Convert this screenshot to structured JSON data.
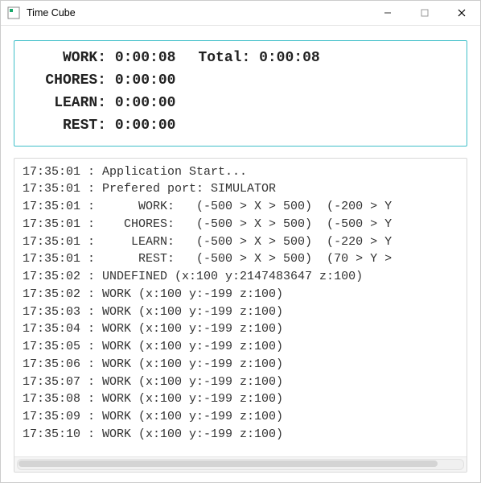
{
  "window": {
    "title": "Time Cube"
  },
  "timers": {
    "work_label": "WORK:",
    "work_value": "0:00:08",
    "chores_label": "CHORES:",
    "chores_value": "0:00:00",
    "learn_label": "LEARN:",
    "learn_value": "0:00:00",
    "rest_label": "REST:",
    "rest_value": "0:00:00",
    "total_label": "Total:",
    "total_value": "0:00:08"
  },
  "log_lines": [
    "17:35:01 : Application Start...",
    "17:35:01 : Prefered port: SIMULATOR",
    "17:35:01 :      WORK:   (-500 > X > 500)  (-200 > Y",
    "17:35:01 :    CHORES:   (-500 > X > 500)  (-500 > Y",
    "17:35:01 :     LEARN:   (-500 > X > 500)  (-220 > Y",
    "17:35:01 :      REST:   (-500 > X > 500)  (70 > Y >",
    "17:35:02 : UNDEFINED (x:100 y:2147483647 z:100)",
    "17:35:02 : WORK (x:100 y:-199 z:100)",
    "17:35:03 : WORK (x:100 y:-199 z:100)",
    "17:35:04 : WORK (x:100 y:-199 z:100)",
    "17:35:05 : WORK (x:100 y:-199 z:100)",
    "17:35:06 : WORK (x:100 y:-199 z:100)",
    "17:35:07 : WORK (x:100 y:-199 z:100)",
    "17:35:08 : WORK (x:100 y:-199 z:100)",
    "17:35:09 : WORK (x:100 y:-199 z:100)",
    "17:35:10 : WORK (x:100 y:-199 z:100)"
  ],
  "colors": {
    "timer_border": "#3fbfc9"
  }
}
